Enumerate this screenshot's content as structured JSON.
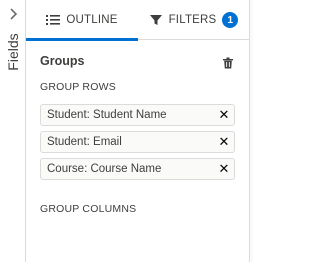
{
  "rail": {
    "label": "Fields",
    "chevron_icon": "chevron-right-icon"
  },
  "tabs": [
    {
      "label": "OUTLINE",
      "icon": "list-icon",
      "active": true
    },
    {
      "label": "FILTERS",
      "icon": "filter-icon",
      "badge": "1",
      "active": false
    }
  ],
  "groups": {
    "title": "Groups",
    "delete_icon": "trash-icon",
    "rows_label": "GROUP ROWS",
    "rows": [
      {
        "label": "Student: Student Name"
      },
      {
        "label": "Student: Email"
      },
      {
        "label": "Course: Course Name"
      }
    ],
    "columns_label": "GROUP COLUMNS"
  },
  "colors": {
    "accent": "#0070d2",
    "border": "#dddbda",
    "text": "#3e3e3c"
  }
}
